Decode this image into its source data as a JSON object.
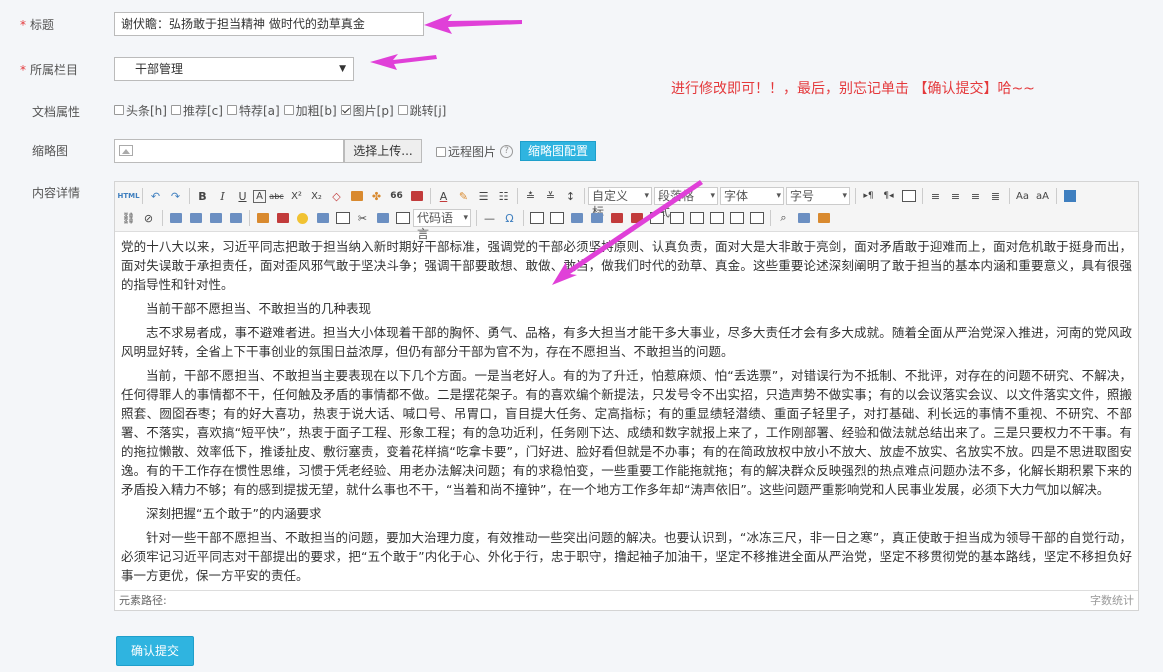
{
  "form": {
    "title_label": "标题",
    "title_value": "谢伏瞻：弘扬敢于担当精神  做时代的劲草真金",
    "column_label": "所属栏目",
    "column_value": "干部管理",
    "attr_label": "文档属性",
    "attributes": [
      {
        "label": "头条[h]",
        "checked": false
      },
      {
        "label": "推荐[c]",
        "checked": false
      },
      {
        "label": "特荐[a]",
        "checked": false
      },
      {
        "label": "加粗[b]",
        "checked": false
      },
      {
        "label": "图片[p]",
        "checked": true
      },
      {
        "label": "跳转[j]",
        "checked": false
      }
    ],
    "thumb_label": "缩略图",
    "upload_label": "选择上传...",
    "remote_label": "远程图片",
    "help_glyph": "?",
    "thumb_config_label": "缩略图配置",
    "content_label": "内容详情",
    "submit_label": "确认提交"
  },
  "annotation": {
    "note": "进行修改即可！！，最后，别忘记单击 【确认提交】哈~~"
  },
  "toolbar": {
    "row1": {
      "html": "HTML",
      "bold": "B",
      "italic": "I",
      "underline": "U",
      "fontborder": "A",
      "strike": "abc",
      "superscript": "X²",
      "subscript": "X₂",
      "blockquote": "66",
      "font_color": "A",
      "custom_title": "自定义标",
      "paragraph_format": "段落格式",
      "font_family": "字体",
      "font_size": "字号"
    },
    "row2": {
      "code_language": "代码语言",
      "horizontal": "—",
      "special_char": "Ω"
    }
  },
  "editor": {
    "paragraphs": [
      {
        "type": "plain",
        "text": "党的十八大以来，习近平同志把敢于担当纳入新时期好干部标准，强调党的干部必须坚持原则、认真负责，面对大是大非敢于亮剑，面对矛盾敢于迎难而上，面对危机敢于挺身而出，面对失误敢于承担责任，面对歪风邪气敢于坚决斗争；强调干部要敢想、敢做、敢当，做我们时代的劲草、真金。这些重要论述深刻阐明了敢于担当的基本内涵和重要意义，具有很强的指导性和针对性。"
      },
      {
        "type": "head",
        "text": "当前干部不愿担当、不敢担当的几种表现"
      },
      {
        "type": "ind",
        "text": "志不求易者成，事不避难者进。担当大小体现着干部的胸怀、勇气、品格，有多大担当才能干多大事业，尽多大责任才会有多大成就。随着全面从严治党深入推进，河南的党风政风明显好转，全省上下干事创业的氛围日益浓厚，但仍有部分干部为官不为，存在不愿担当、不敢担当的问题。"
      },
      {
        "type": "ind",
        "text": "当前，干部不愿担当、不敢担当主要表现在以下几个方面。一是当老好人。有的为了升迁，怕惹麻烦、怕“丢选票”，对错误行为不抵制、不批评，对存在的问题不研究、不解决，任何得罪人的事情都不干，任何触及矛盾的事情都不做。二是摆花架子。有的喜欢编个新提法，只发号令不出实招，只造声势不做实事；有的以会议落实会议、以文件落实文件，照搬照套、囫囵吞枣；有的好大喜功，热衷于说大话、喊口号、吊胃口，盲目提大任务、定高指标；有的重显绩轻潜绩、重面子轻里子，对打基础、利长远的事情不重视、不研究、不部署、不落实，喜欢搞“短平快”，热衷于面子工程、形象工程；有的急功近利，任务刚下达、成绩和数字就报上来了，工作刚部署、经验和做法就总结出来了。三是只要权力不干事。有的拖拉懒散、效率低下，推诿扯皮、敷衍塞责，变着花样搞“吃拿卡要”，门好进、脸好看但就是不办事；有的在简政放权中放小不放大、放虚不放实、名放实不放。四是不思进取图安逸。有的干工作存在惯性思维，习惯于凭老经验、用老办法解决问题；有的求稳怕变，一些重要工作能拖就拖；有的解决群众反映强烈的热点难点问题办法不多，化解长期积累下来的矛盾投入精力不够；有的感到提拔无望，就什么事也不干，“当着和尚不撞钟”，在一个地方工作多年却“涛声依旧”。这些问题严重影响党和人民事业发展，必须下大力气加以解决。"
      },
      {
        "type": "head",
        "text": "深刻把握“五个敢于”的内涵要求"
      },
      {
        "type": "ind",
        "text": "针对一些干部不愿担当、不敢担当的问题，要加大治理力度，有效推动一些突出问题的解决。也要认识到，“冰冻三尺，非一日之寒”，真正使敢于担当成为领导干部的自觉行动，必须牢记习近平同志对干部提出的要求，把“五个敢于”内化于心、外化于行，忠于职守，撸起袖子加油干，坚定不移推进全面从严治党，坚定不移贯彻党的基本路线，坚定不移担负好事一方更优，保一方平安的责任。"
      }
    ],
    "element_path_label": "元素路径:",
    "word_count_label": "字数统计"
  },
  "colors": {
    "accent": "#2fb4e0",
    "required": "#e4393c",
    "arrow": "#e040d8"
  }
}
